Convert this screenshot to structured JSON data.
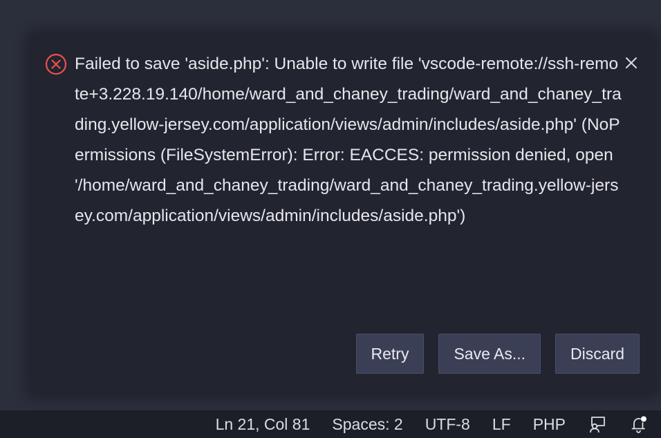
{
  "notification": {
    "message": "Failed to save 'aside.php': Unable to write file 'vscode-remote://ssh-remote+3.228.19.140/home/ward_and_chaney_trading/ward_and_chaney_trading.yellow-jersey.com/application/views/admin/includes/aside.php' (NoPermissions (FileSystemError): Error: EACCES: permission denied, open '/home/ward_and_chaney_trading/ward_and_chaney_trading.yellow-jersey.com/application/views/admin/includes/aside.php')",
    "severity_icon": "error-circle-x-icon",
    "close_icon": "close-icon",
    "actions": {
      "retry": "Retry",
      "save_as": "Save As...",
      "discard": "Discard"
    }
  },
  "statusbar": {
    "cursor_position": "Ln 21, Col 81",
    "indentation": "Spaces: 2",
    "encoding": "UTF-8",
    "line_ending": "LF",
    "language": "PHP",
    "feedback_icon": "feedback-person-icon",
    "notifications_icon": "bell-dot-icon"
  },
  "colors": {
    "error": "#f0504a",
    "background": "#2b2e3b",
    "toast_background": "#22242f",
    "button_background": "#3b3f55",
    "statusbar_background": "#1d1f28"
  }
}
